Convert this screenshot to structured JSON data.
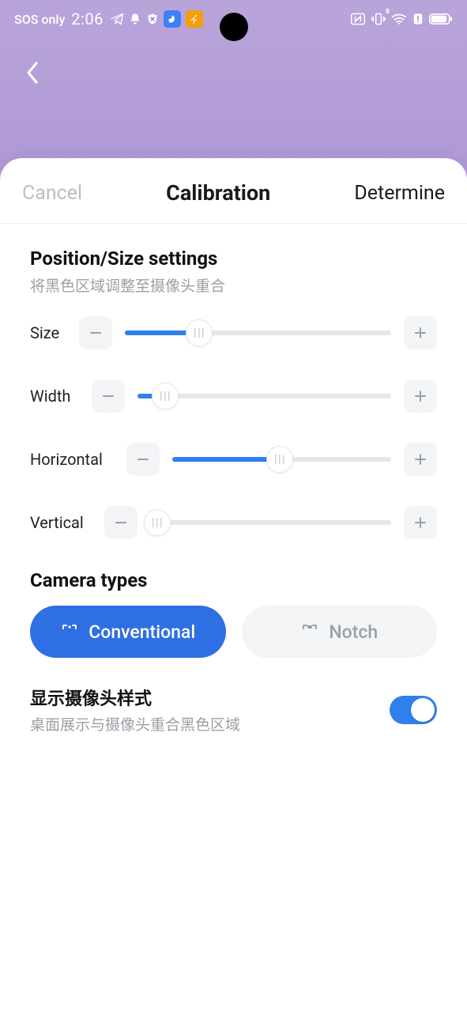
{
  "status": {
    "network_label": "SOS only",
    "time": "2:06",
    "wifi_band": "6"
  },
  "nav": {
    "back_icon": "chevron-left"
  },
  "modal": {
    "cancel": "Cancel",
    "title": "Calibration",
    "confirm": "Determine"
  },
  "position_size": {
    "heading": "Position/Size settings",
    "subtitle": "将黑色区域调整至摄像头重合",
    "rows": {
      "size": {
        "label": "Size",
        "percent": 28
      },
      "width": {
        "label": "Width",
        "percent": 11
      },
      "horizontal": {
        "label": "Horizontal",
        "percent": 49
      },
      "vertical": {
        "label": "Vertical",
        "percent": 3
      }
    }
  },
  "camera_types": {
    "heading": "Camera types",
    "options": {
      "conventional": {
        "label": "Conventional",
        "active": true
      },
      "notch": {
        "label": "Notch",
        "active": false
      }
    }
  },
  "show_camera_style": {
    "title": "显示摄像头样式",
    "subtitle": "桌面展示与摄像头重合黑色区域",
    "enabled": true
  }
}
